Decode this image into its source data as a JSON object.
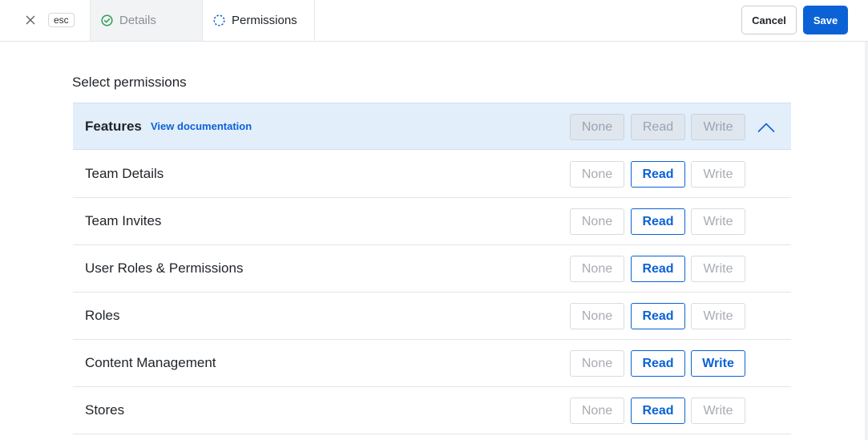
{
  "header": {
    "esc_label": "esc",
    "tabs": [
      {
        "label": "Details",
        "icon": "check-circle-icon",
        "status": "complete"
      },
      {
        "label": "Permissions",
        "icon": "dashed-circle-icon",
        "status": "current"
      }
    ],
    "cancel_label": "Cancel",
    "save_label": "Save"
  },
  "colors": {
    "accent": "#0b62d6",
    "success": "#2e9e57",
    "group_header_bg": "#e3eefb"
  },
  "main": {
    "title": "Select permissions",
    "group": {
      "name": "Features",
      "doc_link": "View documentation",
      "options": [
        "None",
        "Read",
        "Write"
      ],
      "expanded": true
    },
    "options": {
      "none": "None",
      "read": "Read",
      "write": "Write"
    },
    "rows": [
      {
        "label": "Team Details",
        "selected": "read"
      },
      {
        "label": "Team Invites",
        "selected": "read"
      },
      {
        "label": "User Roles & Permissions",
        "selected": "read"
      },
      {
        "label": "Roles",
        "selected": "read"
      },
      {
        "label": "Content Management",
        "selected": "write"
      },
      {
        "label": "Stores",
        "selected": "read"
      }
    ]
  }
}
